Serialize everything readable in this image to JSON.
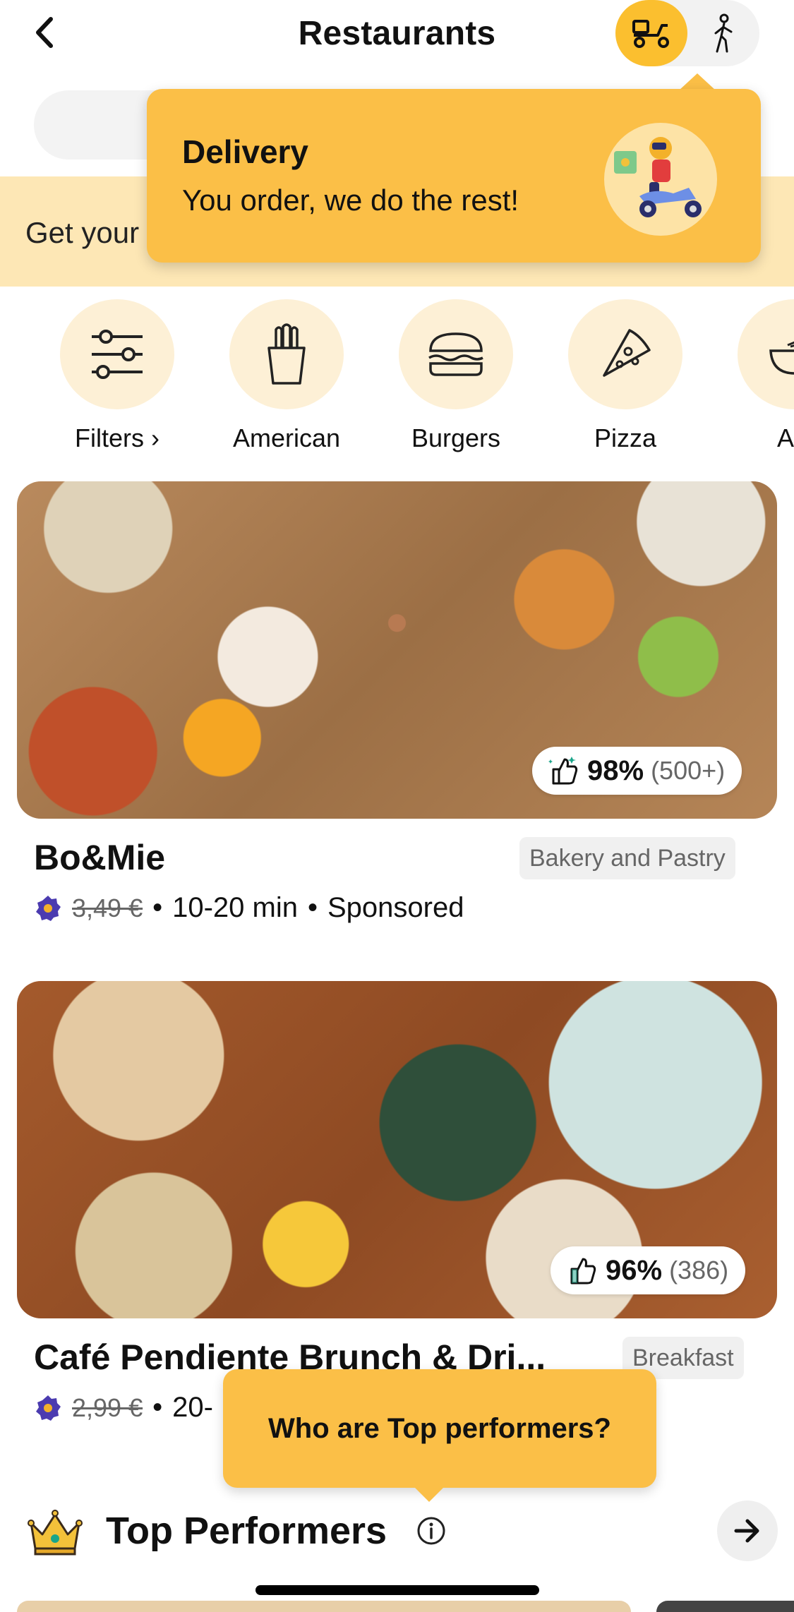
{
  "header": {
    "title": "Restaurants",
    "modes": [
      {
        "name": "delivery",
        "icon": "scooter-icon",
        "active": true
      },
      {
        "name": "pickup",
        "icon": "walking-person-icon",
        "active": false
      }
    ]
  },
  "promo": {
    "text": "Get your"
  },
  "delivery_tooltip": {
    "title": "Delivery",
    "subtitle": "You order, we do the rest!"
  },
  "categories": [
    {
      "label": "Filters ›",
      "icon": "filters-icon"
    },
    {
      "label": "American",
      "icon": "fries-icon"
    },
    {
      "label": "Burgers",
      "icon": "burger-icon"
    },
    {
      "label": "Pizza",
      "icon": "pizza-icon"
    },
    {
      "label": "Asi",
      "icon": "bowl-icon"
    }
  ],
  "restaurants": [
    {
      "name": "Bo&Mie",
      "category": "Bakery and Pastry",
      "rating_pct": "98%",
      "rating_count": "(500+)",
      "delivery_fee": "3,49 €",
      "time": "10-20 min",
      "tag": "Sponsored"
    },
    {
      "name": "Café Pendiente Brunch & Dri...",
      "category": "Breakfast",
      "rating_pct": "96%",
      "rating_count": "(386)",
      "delivery_fee": "2,99 €",
      "time": "20-"
    }
  ],
  "top_tooltip": {
    "text": "Who are Top performers?"
  },
  "top_section": {
    "title": "Top Performers"
  },
  "colors": {
    "accent": "#fbbf2f",
    "tooltip": "#fbbf47",
    "banner": "#fde7b5",
    "category_circle": "#fdf0d6",
    "loyalty_badge": "#4b3bb0"
  }
}
